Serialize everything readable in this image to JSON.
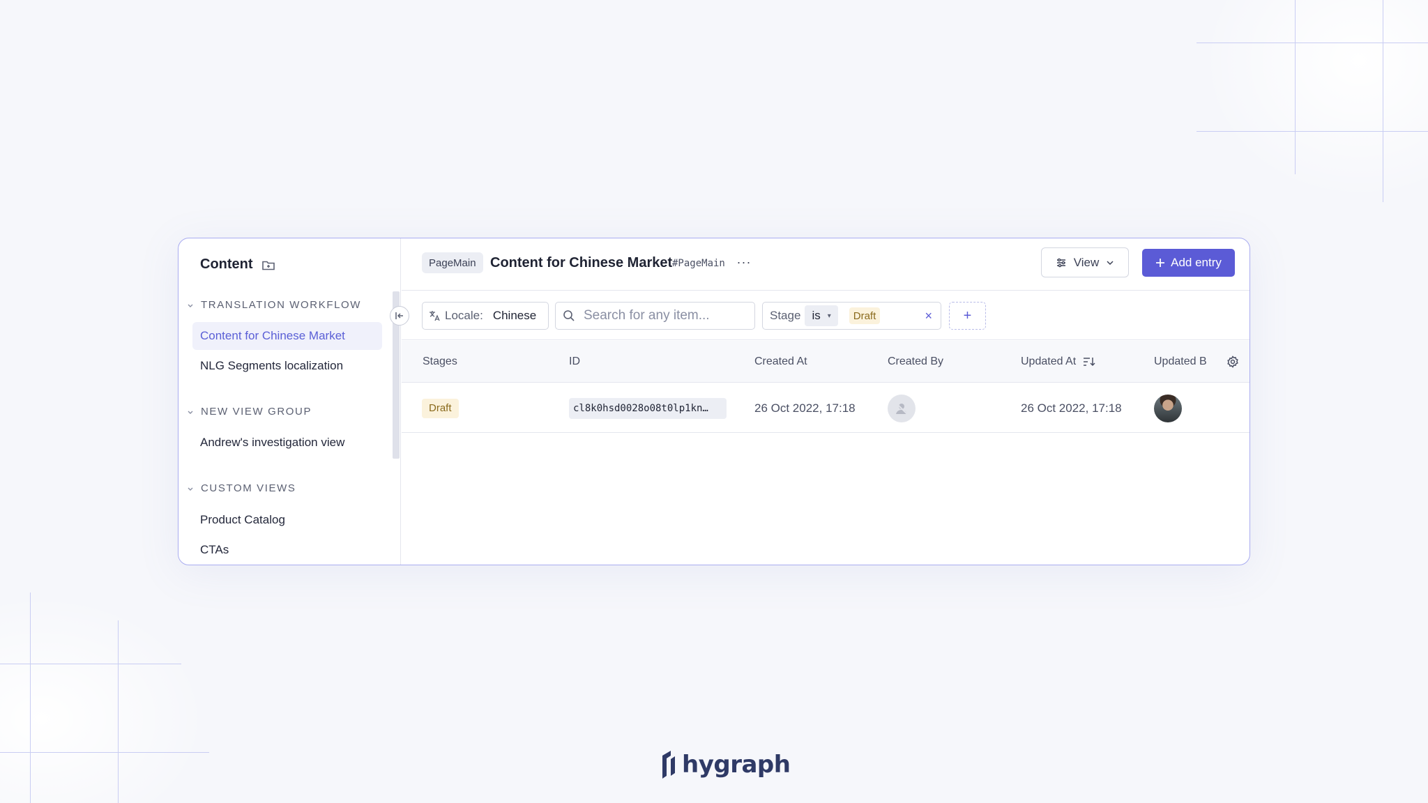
{
  "sidebar": {
    "title": "Content",
    "groups": [
      {
        "label": "TRANSLATION WORKFLOW",
        "items": [
          "Content for Chinese Market",
          "NLG Segments localization"
        ]
      },
      {
        "label": "NEW VIEW GROUP",
        "items": [
          "Andrew's investigation view"
        ]
      },
      {
        "label": "CUSTOM VIEWS",
        "items": [
          "Product Catalog",
          "CTAs"
        ]
      }
    ],
    "active_item": "Content for Chinese Market"
  },
  "header": {
    "model_tag": "PageMain",
    "title": "Content for Chinese Market",
    "api_id": "#PageMain",
    "more": "···",
    "view_label": "View",
    "add_entry_label": "Add entry"
  },
  "filters": {
    "locale_label": "Locale:",
    "locale_value": "Chinese",
    "search_placeholder": "Search for any item...",
    "stage_label": "Stage",
    "stage_operator": "is",
    "stage_value": "Draft",
    "clear": "×",
    "add": "+"
  },
  "table": {
    "columns": [
      "Stages",
      "ID",
      "Created At",
      "Created By",
      "Updated At",
      "Updated B"
    ],
    "rows": [
      {
        "stage": "Draft",
        "id": "cl8k0hsd0028o08t0lp1kn…",
        "created_at": "26 Oct 2022, 17:18",
        "updated_at": "26 Oct 2022, 17:18"
      }
    ]
  },
  "brand": {
    "name": "hygraph",
    "accent": "#5b5bd6"
  }
}
